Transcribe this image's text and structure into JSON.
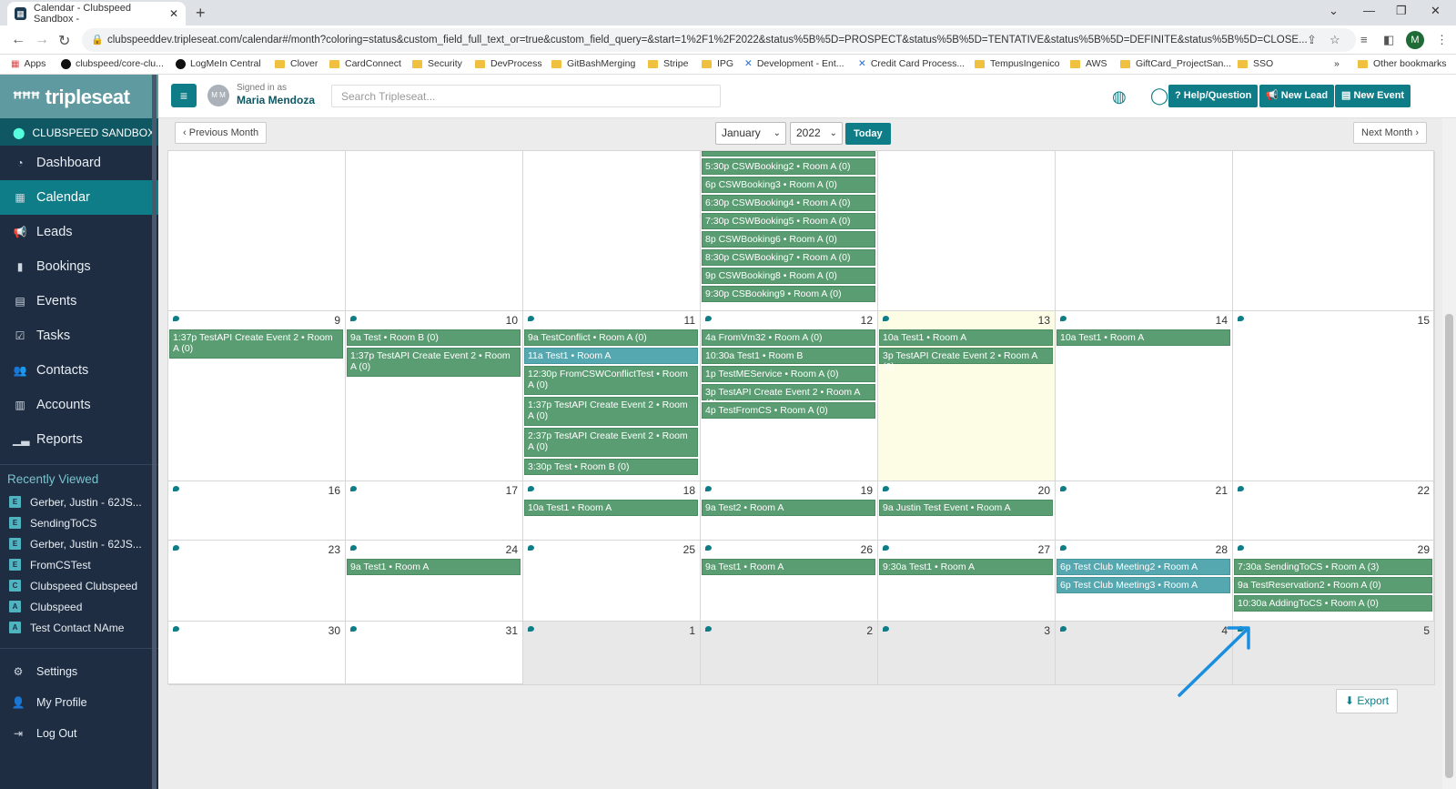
{
  "browser": {
    "tab_title": "Calendar - Clubspeed Sandbox - ",
    "url": "clubspeeddev.tripleseat.com/calendar#/month?coloring=status&custom_field_full_text_or=true&custom_field_query=&start=1%2F1%2F2022&status%5B%5D=PROSPECT&status%5B%5D=TENTATIVE&status%5B%5D=DEFINITE&status%5B%5D=CLOSE...",
    "profile_initial": "M",
    "bookmarks": [
      "Apps",
      "clubspeed/core-clu...",
      "LogMeIn Central",
      "Clover",
      "CardConnect",
      "Security",
      "DevProcess",
      "GitBashMerging",
      "Stripe",
      "IPG",
      "Development - Ent...",
      "Credit Card Process...",
      "TempusIngenico",
      "AWS",
      "GiftCard_ProjectSan...",
      "SSO"
    ],
    "more_bookmarks": "»",
    "other_bookmarks": "Other bookmarks"
  },
  "sidebar": {
    "logo": "tripleseat",
    "location": "CLUBSPEED SANDBOX",
    "nav": [
      {
        "label": "Dashboard",
        "icon": "dashboard-icon"
      },
      {
        "label": "Calendar",
        "icon": "calendar-icon",
        "active": true
      },
      {
        "label": "Leads",
        "icon": "megaphone-icon"
      },
      {
        "label": "Bookings",
        "icon": "bookmark-icon"
      },
      {
        "label": "Events",
        "icon": "events-icon"
      },
      {
        "label": "Tasks",
        "icon": "checkbox-icon"
      },
      {
        "label": "Contacts",
        "icon": "contacts-icon"
      },
      {
        "label": "Accounts",
        "icon": "building-icon"
      },
      {
        "label": "Reports",
        "icon": "chart-icon"
      }
    ],
    "recently_viewed_title": "Recently Viewed",
    "recently_viewed": [
      {
        "badge": "E",
        "label": "Gerber, Justin - 62JS..."
      },
      {
        "badge": "E",
        "label": "SendingToCS"
      },
      {
        "badge": "E",
        "label": "Gerber, Justin - 62JS..."
      },
      {
        "badge": "E",
        "label": "FromCSTest"
      },
      {
        "badge": "C",
        "label": "Clubspeed Clubspeed"
      },
      {
        "badge": "A",
        "label": "Clubspeed"
      },
      {
        "badge": "A",
        "label": "Test Contact NAme"
      }
    ],
    "bottom": [
      {
        "label": "Settings",
        "icon": "gear-icon"
      },
      {
        "label": "My Profile",
        "icon": "user-icon"
      },
      {
        "label": "Log Out",
        "icon": "logout-icon"
      }
    ]
  },
  "topbar": {
    "avatar_initials": "M M",
    "signed_in_label": "Signed in as",
    "user_name": "Maria Mendoza",
    "search_placeholder": "Search Tripleseat...",
    "help_label": "Help/Question",
    "new_lead_label": "New Lead",
    "new_event_label": "New Event"
  },
  "calendar": {
    "prev_label": "Previous Month",
    "next_label": "Next Month",
    "month": "January",
    "year": "2022",
    "today_label": "Today",
    "export_label": "Export",
    "weeks": [
      {
        "days": [
          {
            "num": "",
            "events": []
          },
          {
            "num": "",
            "events": []
          },
          {
            "num": "",
            "events": []
          },
          {
            "num": "",
            "events": [
              {
                "text": "5:30p CSWBooking2 • Room A (0)"
              },
              {
                "text": "6p CSWBooking3 • Room A (0)"
              },
              {
                "text": "6:30p CSWBooking4 • Room A (0)"
              },
              {
                "text": "7:30p CSWBooking5 • Room A (0)"
              },
              {
                "text": "8p CSWBooking6 • Room A (0)"
              },
              {
                "text": "8:30p CSWBooking7 • Room A (0)"
              },
              {
                "text": "9p CSWBooking8 • Room A (0)"
              },
              {
                "text": "9:30p CSBooking9 • Room A (0)"
              }
            ]
          },
          {
            "num": "",
            "events": []
          },
          {
            "num": "",
            "events": []
          },
          {
            "num": "",
            "events": []
          }
        ]
      },
      {
        "days": [
          {
            "num": "9",
            "events": [
              {
                "text": "1:37p TestAPI Create Event 2 • Room A (0)",
                "lines": 2
              }
            ]
          },
          {
            "num": "10",
            "events": [
              {
                "text": "9a Test • Room B (0)"
              },
              {
                "text": "1:37p TestAPI Create Event 2 • Room A (0)",
                "lines": 2
              }
            ]
          },
          {
            "num": "11",
            "events": [
              {
                "text": "9a TestConflict • Room A (0)"
              },
              {
                "text": "11a Test1 • Room A",
                "color": "blue"
              },
              {
                "text": "12:30p FromCSWConflictTest • Room A (0)",
                "lines": 2
              },
              {
                "text": "1:37p TestAPI Create Event 2 • Room A (0)",
                "lines": 2
              },
              {
                "text": "2:37p TestAPI Create Event 2 • Room A (0)",
                "lines": 2
              },
              {
                "text": "3:30p Test • Room B (0)"
              }
            ]
          },
          {
            "num": "12",
            "events": [
              {
                "text": "4a FromVm32 • Room A (0)"
              },
              {
                "text": "10:30a Test1 • Room B"
              },
              {
                "text": "1p TestMEService • Room A (0)"
              },
              {
                "text": "3p TestAPI Create Event 2 • Room A (0)"
              },
              {
                "text": "4p TestFromCS • Room A (0)"
              }
            ]
          },
          {
            "num": "13",
            "today": true,
            "events": [
              {
                "text": "10a Test1 • Room A"
              },
              {
                "text": "3p TestAPI Create Event 2 • Room A (0)"
              }
            ]
          },
          {
            "num": "14",
            "events": [
              {
                "text": "10a Test1 • Room A"
              }
            ]
          },
          {
            "num": "15",
            "events": []
          }
        ]
      },
      {
        "days": [
          {
            "num": "16",
            "events": []
          },
          {
            "num": "17",
            "events": []
          },
          {
            "num": "18",
            "events": [
              {
                "text": "10a Test1 • Room A"
              }
            ]
          },
          {
            "num": "19",
            "events": [
              {
                "text": "9a Test2 • Room A"
              }
            ]
          },
          {
            "num": "20",
            "events": [
              {
                "text": "9a Justin Test Event • Room A"
              }
            ]
          },
          {
            "num": "21",
            "events": []
          },
          {
            "num": "22",
            "events": []
          }
        ]
      },
      {
        "days": [
          {
            "num": "23",
            "events": []
          },
          {
            "num": "24",
            "events": [
              {
                "text": "9a Test1 • Room A"
              }
            ]
          },
          {
            "num": "25",
            "events": []
          },
          {
            "num": "26",
            "events": [
              {
                "text": "9a Test1 • Room A"
              }
            ]
          },
          {
            "num": "27",
            "events": [
              {
                "text": "9:30a Test1 • Room A"
              }
            ]
          },
          {
            "num": "28",
            "events": [
              {
                "text": "6p Test Club Meeting2 • Room A",
                "color": "blue"
              },
              {
                "text": "6p Test Club Meeting3 • Room A",
                "color": "blue"
              }
            ]
          },
          {
            "num": "29",
            "events": [
              {
                "text": "7:30a SendingToCS • Room A (3)"
              },
              {
                "text": "9a TestReservation2 • Room A (0)"
              },
              {
                "text": "10:30a AddingToCS • Room A (0)"
              }
            ]
          }
        ]
      },
      {
        "days": [
          {
            "num": "30",
            "events": []
          },
          {
            "num": "31",
            "events": []
          },
          {
            "num": "1",
            "other": true,
            "events": []
          },
          {
            "num": "2",
            "other": true,
            "events": []
          },
          {
            "num": "3",
            "other": true,
            "events": []
          },
          {
            "num": "4",
            "other": true,
            "events": []
          },
          {
            "num": "5",
            "other": true,
            "events": []
          }
        ]
      }
    ]
  },
  "colors": {
    "accent": "#0e7d87",
    "event_green": "#5b9d72",
    "event_blue": "#56a8b0",
    "annotation_arrow": "#1a8fe0"
  }
}
